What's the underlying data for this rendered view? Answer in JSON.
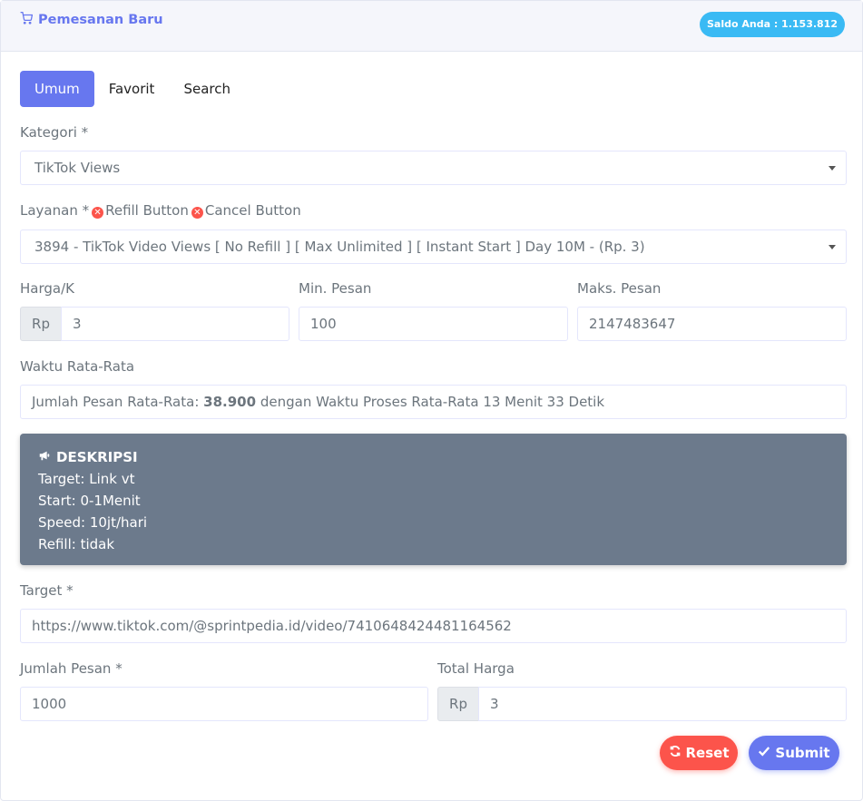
{
  "header": {
    "title": "Pemesanan Baru",
    "title_icon": "cart-icon",
    "saldo": "Saldo Anda : 1.153.812"
  },
  "tabs": [
    {
      "label": "Umum",
      "active": true
    },
    {
      "label": "Favorit",
      "active": false
    },
    {
      "label": "Search",
      "active": false
    }
  ],
  "kategori": {
    "label": "Kategori *",
    "value": "TikTok Views"
  },
  "layanan": {
    "label": "Layanan *",
    "refill_label": "Refill Button",
    "cancel_label": "Cancel Button",
    "value": "3894 - TikTok Video Views [ No Refill ] [ Max Unlimited ] [ Instant Start ] Day 10M - (Rp. 3)"
  },
  "harga": {
    "label": "Harga/K",
    "prefix": "Rp",
    "value": "3"
  },
  "min_pesan": {
    "label": "Min. Pesan",
    "value": "100"
  },
  "maks_pesan": {
    "label": "Maks. Pesan",
    "value": "2147483647"
  },
  "waktu": {
    "label": "Waktu Rata-Rata",
    "text_prefix": "Jumlah Pesan Rata-Rata:",
    "count": "38.900",
    "text_suffix": "dengan Waktu Proses Rata-Rata 13 Menit 33 Detik"
  },
  "deskripsi": {
    "title": "DESKRIPSI",
    "lines": [
      "Target: Link vt",
      "Start: 0-1Menit",
      "Speed: 10jt/hari",
      "Refill: tidak"
    ]
  },
  "target": {
    "label": "Target *",
    "value": "https://www.tiktok.com/@sprintpedia.id/video/7410648424481164562"
  },
  "jumlah_pesan": {
    "label": "Jumlah Pesan *",
    "value": "1000"
  },
  "total_harga": {
    "label": "Total Harga",
    "prefix": "Rp",
    "value": "3"
  },
  "buttons": {
    "reset": "Reset",
    "submit": "Submit"
  },
  "colors": {
    "primary": "#6777ef",
    "info": "#3abaf4",
    "danger": "#fc544b",
    "desc_bg": "#6c7a8c"
  }
}
